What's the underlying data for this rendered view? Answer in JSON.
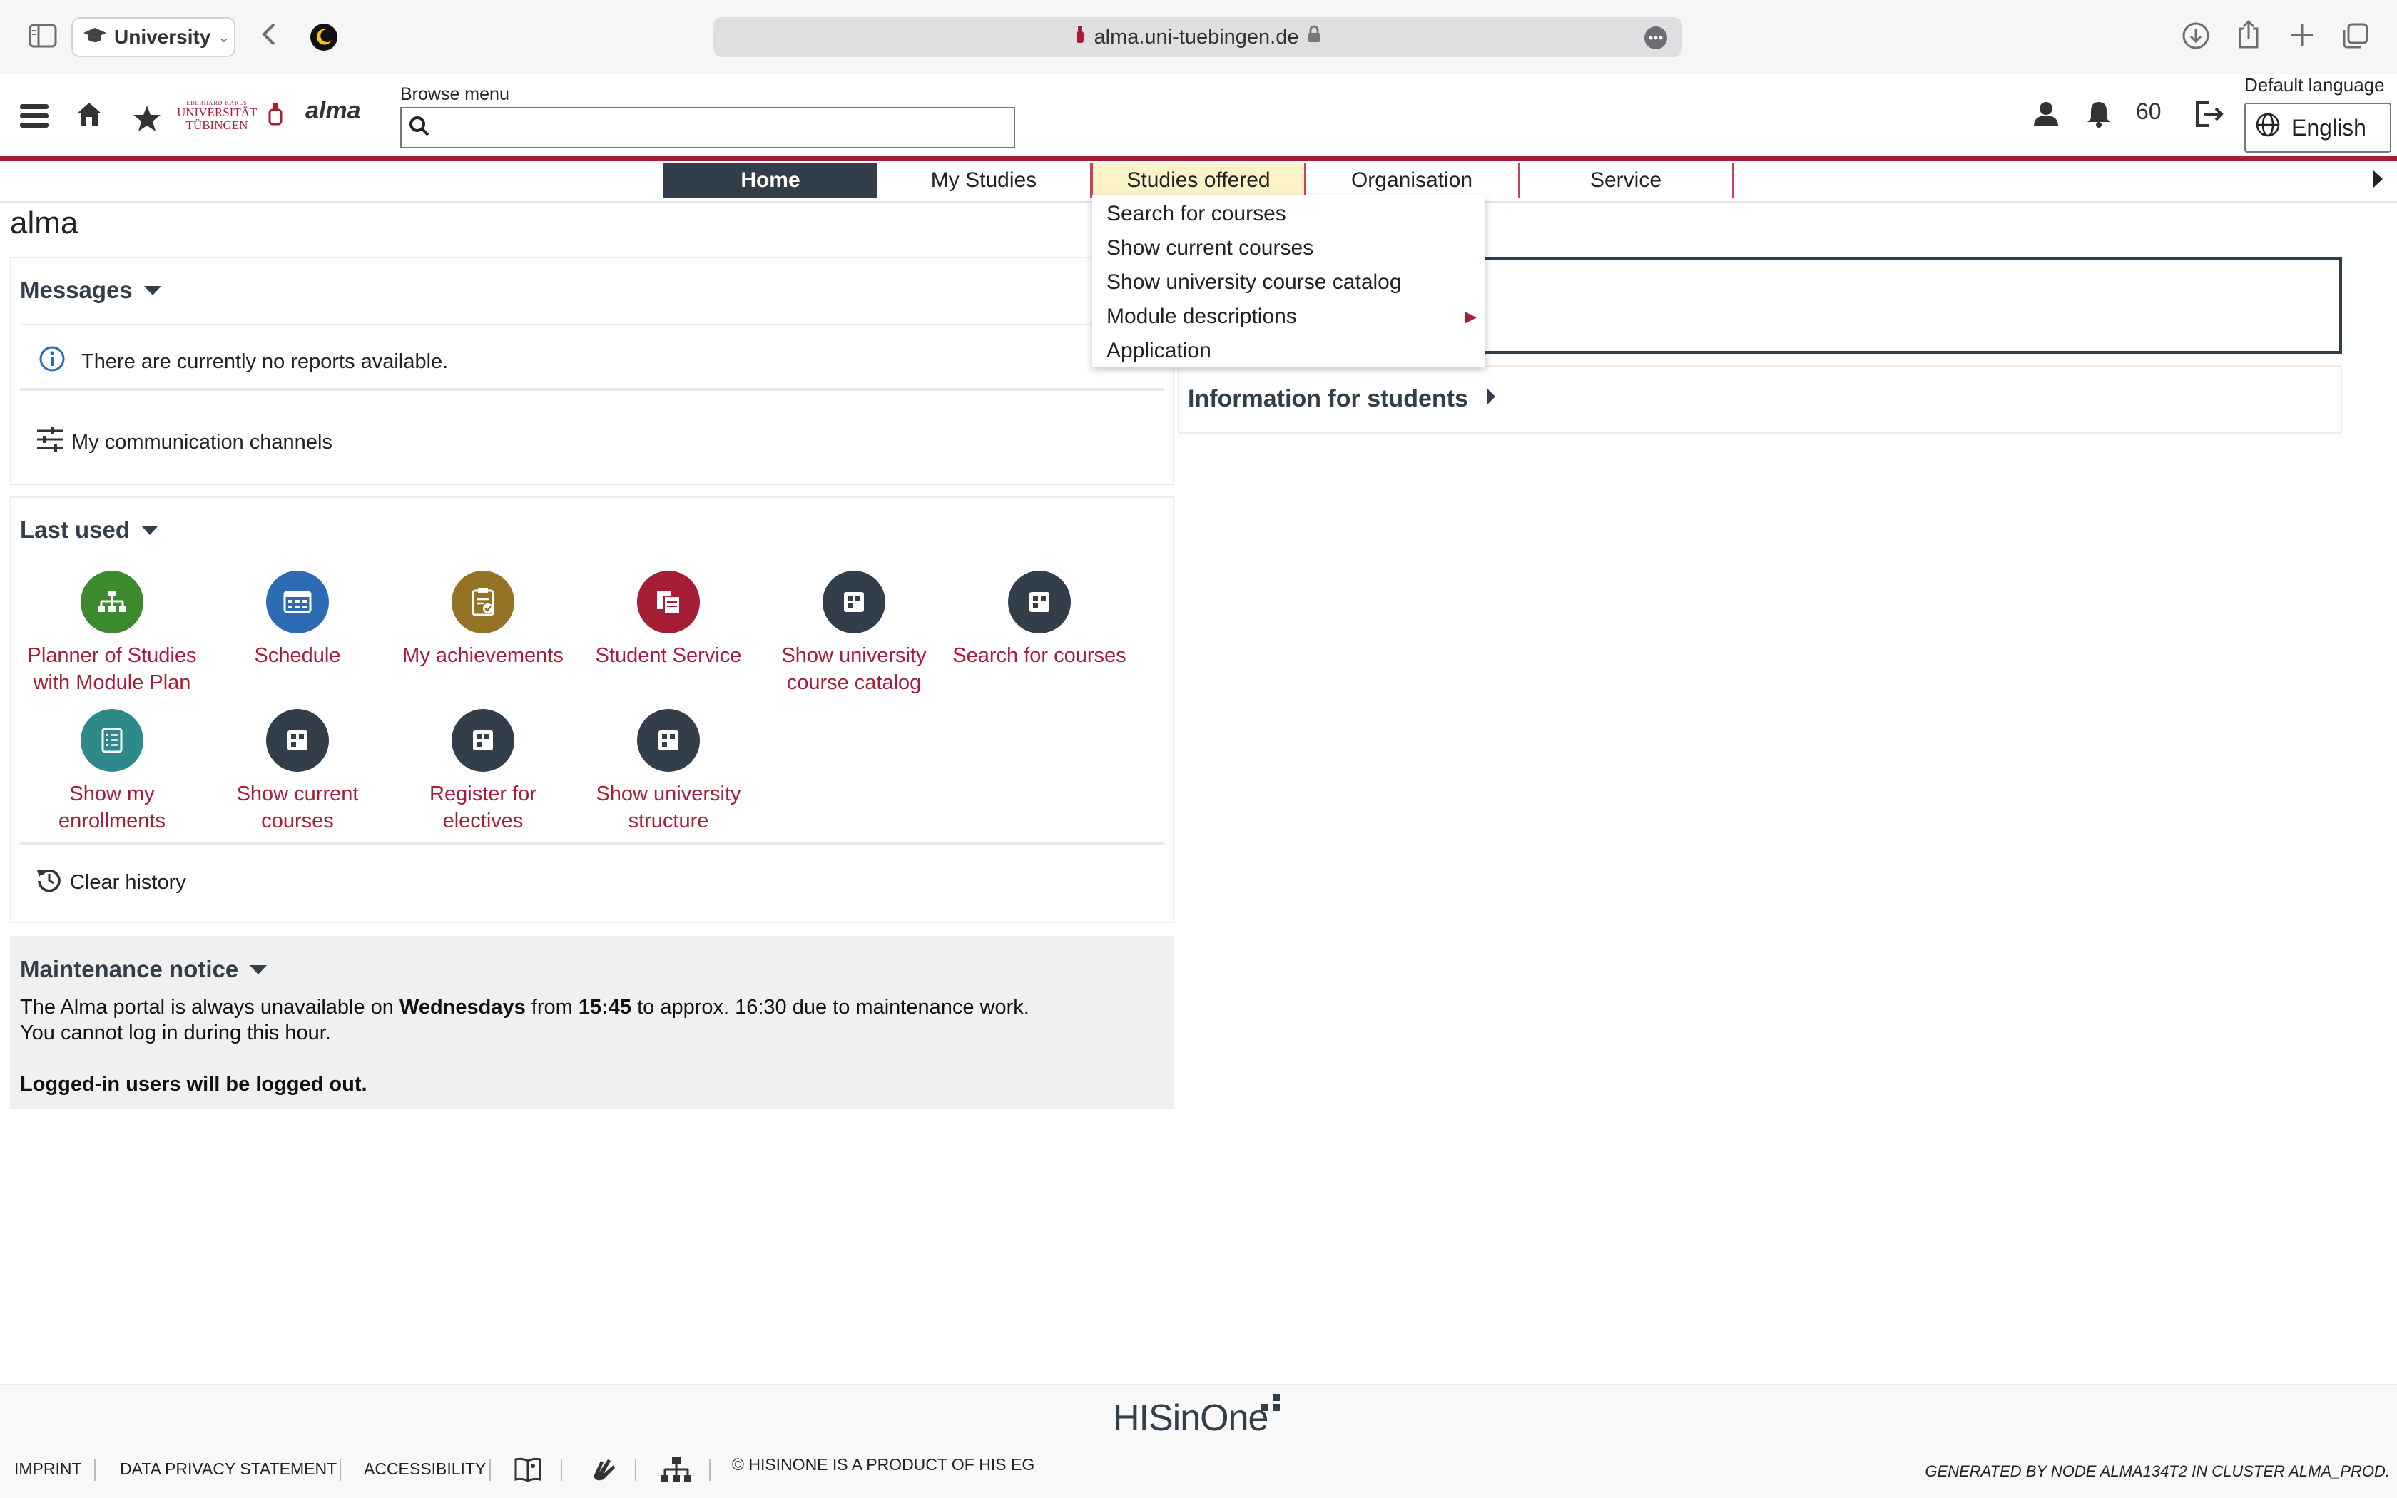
{
  "browser": {
    "tab_group_label": "University",
    "url": "alma.uni-tuebingen.de"
  },
  "header": {
    "logo_line1": "EBERHARD KARLS",
    "logo_line2": "UNIVERSITÄT",
    "logo_line3": "TÜBINGEN",
    "app_name": "alma",
    "browse_label": "Browse menu",
    "browse_placeholder": "",
    "notification_count": "60",
    "language_label": "Default language",
    "language_value": "English"
  },
  "nav": {
    "tabs": [
      {
        "label": "Home"
      },
      {
        "label": "My Studies"
      },
      {
        "label": "Studies offered"
      },
      {
        "label": "Organisation"
      },
      {
        "label": "Service"
      }
    ]
  },
  "dropdown": {
    "items": [
      {
        "label": "Search for courses"
      },
      {
        "label": "Show current courses"
      },
      {
        "label": "Show university course catalog"
      },
      {
        "label": "Module descriptions"
      },
      {
        "label": "Application"
      }
    ]
  },
  "page": {
    "title": "alma"
  },
  "messages": {
    "title": "Messages",
    "no_reports": "There are currently no reports available.",
    "channels_link": "My communication channels"
  },
  "last_used": {
    "title": "Last used",
    "tiles": [
      {
        "label": "Planner of Studies with Module Plan",
        "icon": "sitemap-icon",
        "color": "#3d8a2e"
      },
      {
        "label": "Schedule",
        "icon": "calendar-grid-icon",
        "color": "#2d6cb5"
      },
      {
        "label": "My achievements",
        "icon": "clipboard-check-icon",
        "color": "#957326"
      },
      {
        "label": "Student Service",
        "icon": "documents-icon",
        "color": "#a51e36"
      },
      {
        "label": "Show university course catalog",
        "icon": "module-icon",
        "color": "#323f4b"
      },
      {
        "label": "Search for courses",
        "icon": "module-icon",
        "color": "#323f4b"
      },
      {
        "label": "Show my enrollments",
        "icon": "list-document-icon",
        "color": "#2e8a8a"
      },
      {
        "label": "Show current courses",
        "icon": "module-icon",
        "color": "#323f4b"
      },
      {
        "label": "Register for electives",
        "icon": "module-icon",
        "color": "#323f4b"
      },
      {
        "label": "Show university structure",
        "icon": "module-icon",
        "color": "#323f4b"
      }
    ],
    "clear_history": "Clear history"
  },
  "maintenance": {
    "title": "Maintenance notice",
    "line1_a": "The Alma portal is always unavailable on ",
    "line1_b": "Wednesdays",
    "line1_c": " from ",
    "line1_d": "15:45",
    "line1_e": " to approx. 16:30 due to maintenance work.",
    "line2": "You cannot log in during this hour.",
    "line3": "Logged-in users will be logged out."
  },
  "right": {
    "info_students": "Information for students"
  },
  "footer": {
    "his_logo": "HISinOne",
    "imprint": "IMPRINT",
    "privacy": "DATA PRIVACY STATEMENT",
    "accessibility": "ACCESSIBILITY",
    "copyright": "© HISINONE IS A PRODUCT OF HIS EG",
    "generated": "GENERATED BY NODE ALMA134T2 IN CLUSTER ALMA_PROD."
  },
  "colors": {
    "brand_red": "#a51e36",
    "dark_slate": "#323f4b",
    "hover_yellow": "#fdf3c9"
  }
}
